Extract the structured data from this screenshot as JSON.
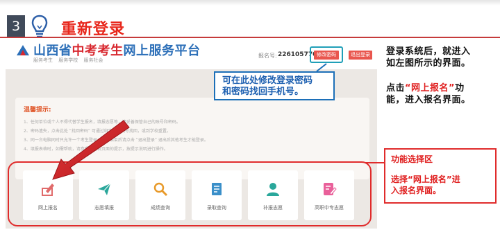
{
  "slide": {
    "number": "3",
    "title": "重新登录",
    "accent_color": "#e8271c"
  },
  "site": {
    "name_part1": "山西省",
    "name_part2": "中考考生",
    "name_part3": "网上服务平台",
    "nav": [
      "服务考生",
      "服务学校",
      "服务社会"
    ],
    "reg_label": "报名号:",
    "reg_value": "226105770005",
    "modify_button": "修改密码",
    "logout_button": "退出登录"
  },
  "callout": {
    "line1": "可在此处修改登录密码",
    "line2": "和密码找回手机号。"
  },
  "tips": {
    "title": "温馨提示:",
    "items": [
      "1、任何单位或个人不得代替学生报名，填报志愿等，请妥善保管自己的账号和密码。",
      "2、密码遗失，点击此处 “找回密码” 可通过绑定的手机号找回，或到学校重置。",
      "3、同一台电脑同时只允许一个考生登录，操作结束后请点击 “退出登录” 退出后其他考生才能登录。",
      "4、填报表格时，如需帮助，请参照系统各页面的提示，按提示说明进行操作。"
    ]
  },
  "tiles": [
    {
      "label": "网上报名",
      "icon": "pen-form-icon"
    },
    {
      "label": "志愿填报",
      "icon": "paper-plane-icon"
    },
    {
      "label": "成绩查询",
      "icon": "magnifier-icon"
    },
    {
      "label": "录取查询",
      "icon": "document-icon"
    },
    {
      "label": "补报志愿",
      "icon": "person-icon"
    },
    {
      "label": "高职中专志愿",
      "icon": "edit-form-icon"
    }
  ],
  "side": {
    "para1_line1": "登录系统后，就进入",
    "para1_line2": "如左图所示的界面。",
    "para2_prefix": "点击",
    "para2_highlight": "“网上报名”",
    "para2_suffix": "功",
    "para2_line2": "能，进入报名界面。"
  },
  "func_box": {
    "title": "功能选择区",
    "line1": "选择“网上报名”进",
    "line2": "入报名界面。"
  }
}
